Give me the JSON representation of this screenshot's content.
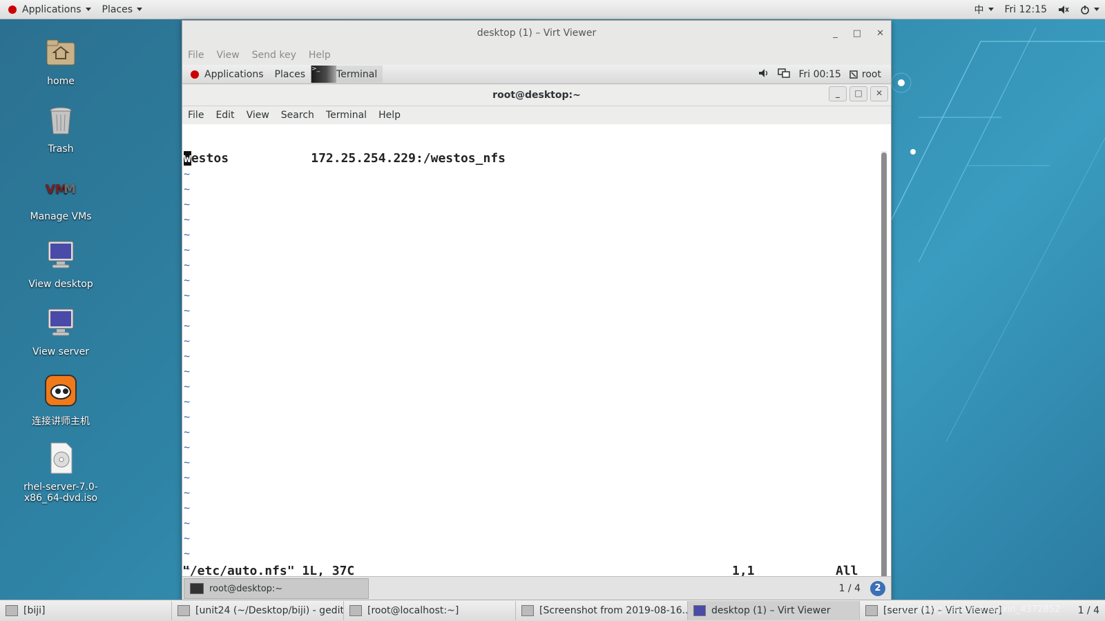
{
  "top_panel": {
    "applications": "Applications",
    "places": "Places",
    "input_method": "中",
    "clock": "Fri 12:15"
  },
  "desktop_icons": [
    {
      "label": "home",
      "icon": "home-folder-icon"
    },
    {
      "label": "Trash",
      "icon": "trash-icon"
    },
    {
      "label": "Manage VMs",
      "icon": "vm-icon"
    },
    {
      "label": "View desktop",
      "icon": "monitor-icon"
    },
    {
      "label": "View server",
      "icon": "monitor-icon"
    },
    {
      "label": "连接讲师主机",
      "icon": "remote-app-icon"
    },
    {
      "label": "rhel-server-7.0-x86_64-dvd.iso",
      "icon": "disc-image-icon"
    }
  ],
  "virt_viewer": {
    "title": "desktop (1) – Virt Viewer",
    "menu": [
      "File",
      "View",
      "Send key",
      "Help"
    ]
  },
  "guest_panel": {
    "applications": "Applications",
    "places": "Places",
    "terminal_tab": "Terminal",
    "clock": "Fri 00:15",
    "user": "root"
  },
  "terminal": {
    "title": "root@desktop:~",
    "menu": [
      "File",
      "Edit",
      "View",
      "Search",
      "Terminal",
      "Help"
    ],
    "first_line_cursor_char": "w",
    "first_line_rest": "estos           172.25.254.229:/westos_nfs",
    "tilde": "~",
    "status_file": "\"/etc/auto.nfs\" 1L, 37C",
    "status_pos": "1,1",
    "status_scroll": "All"
  },
  "guest_taskbar": {
    "task": "root@desktop:~",
    "workspace": "1 / 4",
    "help": "2"
  },
  "host_taskbar": {
    "items": [
      "[biji]",
      "[unit24 (~/Desktop/biji) - gedit]",
      "[root@localhost:~]",
      "[Screenshot from 2019-08-16...",
      "desktop (1) – Virt Viewer",
      "[server (1) – Virt Viewer]"
    ],
    "workspace": "1 / 4",
    "watermark": "https://blog.csdn.net/weixin_4372852"
  }
}
